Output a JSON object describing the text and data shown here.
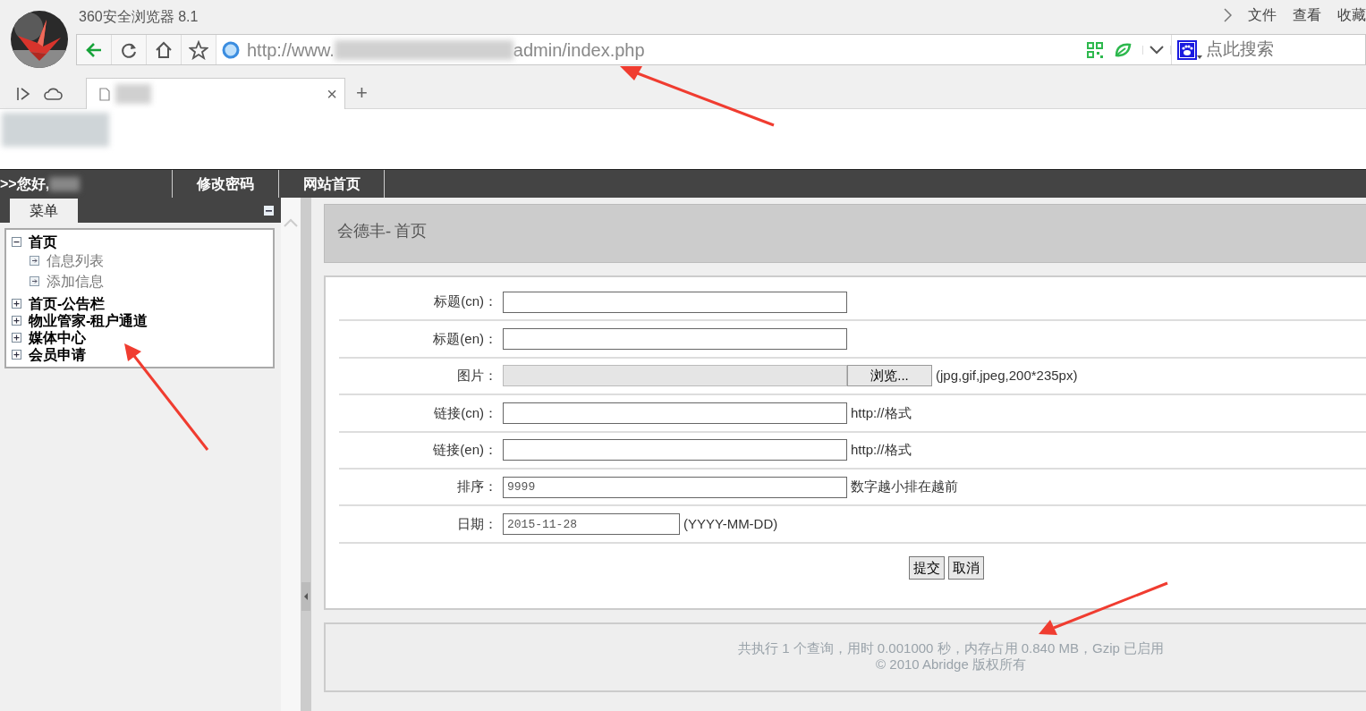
{
  "browser": {
    "title": "360安全浏览器 8.1",
    "menu": [
      "文件",
      "查看",
      "收藏"
    ],
    "url_start": "http://www.",
    "url_end": "admin/index.php",
    "search_placeholder": "点此搜索",
    "tab_close": "×",
    "new_tab": "+"
  },
  "top_nav": {
    "greeting": ">>您好,",
    "links": [
      "修改密码",
      "网站首页"
    ]
  },
  "sidebar": {
    "tab": "菜单",
    "tree": [
      {
        "label": "首页",
        "expanded": true,
        "children": [
          {
            "label": "信息列表"
          },
          {
            "label": "添加信息"
          }
        ]
      },
      {
        "label": "首页-公告栏",
        "expanded": false
      },
      {
        "label": "物业管家-租户通道",
        "expanded": false
      },
      {
        "label": "媒体中心",
        "expanded": false
      },
      {
        "label": "会员申请",
        "expanded": false
      }
    ]
  },
  "page_title": "会德丰- 首页",
  "form": {
    "rows": [
      {
        "kind": "text",
        "label": "标题(cn)："
      },
      {
        "kind": "text",
        "label": "标题(en)："
      },
      {
        "kind": "file",
        "label": "图片：",
        "button": "浏览...",
        "hint": "(jpg,gif,jpeg,200*235px)"
      },
      {
        "kind": "text",
        "label": "链接(cn)：",
        "hint": "http://格式"
      },
      {
        "kind": "text",
        "label": "链接(en)：",
        "hint": "http://格式"
      },
      {
        "kind": "text",
        "label": "排序：",
        "value": "9999",
        "hint": "数字越小排在越前"
      },
      {
        "kind": "date",
        "label": "日期：",
        "value": "2015-11-28",
        "hint": "(YYYY-MM-DD)"
      }
    ],
    "buttons": [
      "提交",
      "取消"
    ]
  },
  "footer": [
    "共执行  1 个查询，用时  0.001000 秒，内存占用  0.840 MB，Gzip 已启用",
    "© 2010 Abridge 版权所有"
  ]
}
